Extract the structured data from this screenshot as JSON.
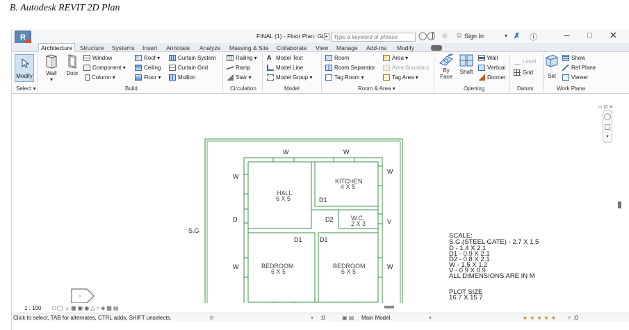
{
  "caption": "B.   Autodesk REVIT 2D Plan",
  "titlebar": {
    "app_button": "R",
    "doc_title": "FINAL (1) - Floor Plan: GL",
    "search_placeholder": "Type a keyword or phrase",
    "sign_in": "Sign In"
  },
  "tabs": [
    "Architecture",
    "Structure",
    "Systems",
    "Insert",
    "Annotate",
    "Analyze",
    "Massing & Site",
    "Collaborate",
    "View",
    "Manage",
    "Add-Ins",
    "Modify"
  ],
  "ribbon": {
    "select": {
      "modify": "Modify",
      "label": "Select ▾"
    },
    "build": {
      "label": "Build",
      "wall": "Wall",
      "door": "Door",
      "window": "Window",
      "component": "Component ▾",
      "column": "Column ▾",
      "roof": "Roof ▾",
      "ceiling": "Ceiling",
      "floor": "Floor ▾",
      "curtain_system": "Curtain System",
      "curtain_grid": "Curtain Grid",
      "mullion": "Mullion"
    },
    "circulation": {
      "label": "Circulation",
      "railing": "Railing ▾",
      "ramp": "Ramp",
      "stair": "Stair ▾"
    },
    "model": {
      "label": "Model",
      "model_text": "Model Text",
      "model_line": "Model Line",
      "model_group": "Model Group ▾"
    },
    "room_area": {
      "label": "Room & Area ▾",
      "room": "Room",
      "room_separator": "Room Separator",
      "tag_room": "Tag Room ▾",
      "area": "Area ▾",
      "area_boundary": "Area Boundary",
      "tag_area": "Tag Area ▾"
    },
    "opening": {
      "label": "Opening",
      "by_face": "By\nFace",
      "shaft": "Shaft",
      "wall": "Wall",
      "vertical": "Vertical",
      "dormer": "Dormer"
    },
    "datum": {
      "label": "Datum",
      "level": "Level",
      "grid": "Grid"
    },
    "work_plane": {
      "label": "Work Plane",
      "set": "Set",
      "show": "Show",
      "ref_plane": "Ref Plane",
      "viewer": "Viewer"
    }
  },
  "plan": {
    "rooms": {
      "hall": "HALL",
      "hall_size": "6 X 5",
      "kitchen": "KITCHEN",
      "kitchen_size": "4 X 5",
      "wc": "W.C.",
      "wc_size": "2 X 3",
      "bedroom1": "BEDROOM",
      "bedroom1_size": "6 X 5",
      "bedroom2": "BEDROOM",
      "bedroom2_size": "6 X 5"
    },
    "marks": {
      "w": "W",
      "d": "D",
      "d1": "D1",
      "d2": "D2",
      "v": "V",
      "sg": "S.G"
    },
    "notes": [
      "SCALE:",
      "S.G.(STEEL GATE) - 2.7 X 1.5",
      "D - 1.4 X 2.1",
      "D1 - 0.9 X 2.1",
      "D2 - 0.8 X 2.1",
      "W - 1.5 X 1.2",
      "V - 0.9 X 0.9",
      "ALL DIMENSIONS ARE IN M"
    ],
    "plot_size_label": "PLOT SIZE",
    "plot_size_value": "16.7 X 15.7"
  },
  "status": {
    "scale": "1 : 100",
    "hint": "Click to select, TAB for alternates, CTRL adds, SHIFT unselects.",
    "zero": ":0",
    "model": "Main Model",
    "filter": ":0"
  }
}
